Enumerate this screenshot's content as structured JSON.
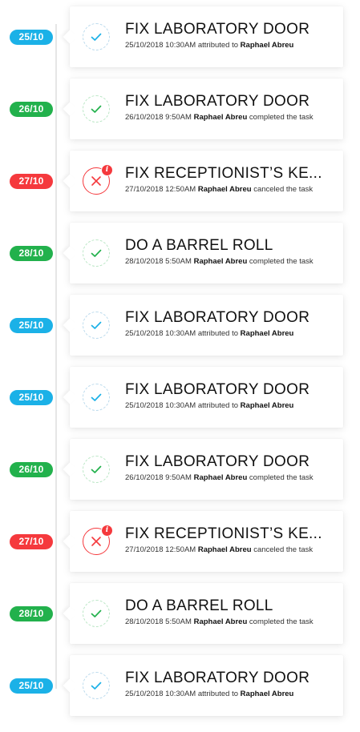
{
  "colors": {
    "assigned": "#1bb1e7",
    "completed": "#22b14c",
    "canceled": "#f5393d"
  },
  "entries": [
    {
      "date": "25/10",
      "status": "assigned",
      "title": "FIX LABORATORY DOOR",
      "timestamp": "25/10/2018 10:30AM",
      "pre": "attributed to",
      "user": "Raphael Abreu",
      "post": ""
    },
    {
      "date": "26/10",
      "status": "completed",
      "title": "FIX LABORATORY DOOR",
      "timestamp": "26/10/2018 9:50AM",
      "pre": "",
      "user": "Raphael Abreu",
      "post": "completed the task"
    },
    {
      "date": "27/10",
      "status": "canceled",
      "title": "FIX RECEPTIONIST’S KE...",
      "timestamp": "27/10/2018 12:50AM",
      "pre": "",
      "user": "Raphael Abreu",
      "post": "canceled the task"
    },
    {
      "date": "28/10",
      "status": "completed",
      "title": "DO A BARREL ROLL",
      "timestamp": "28/10/2018 5:50AM",
      "pre": "",
      "user": "Raphael Abreu",
      "post": "completed the task"
    },
    {
      "date": "25/10",
      "status": "assigned",
      "title": "FIX LABORATORY DOOR",
      "timestamp": "25/10/2018 10:30AM",
      "pre": "attributed to",
      "user": "Raphael Abreu",
      "post": ""
    },
    {
      "date": "25/10",
      "status": "assigned",
      "title": "FIX LABORATORY DOOR",
      "timestamp": "25/10/2018 10:30AM",
      "pre": "attributed to",
      "user": "Raphael Abreu",
      "post": ""
    },
    {
      "date": "26/10",
      "status": "completed",
      "title": "FIX LABORATORY DOOR",
      "timestamp": "26/10/2018 9:50AM",
      "pre": "",
      "user": "Raphael Abreu",
      "post": "completed the task"
    },
    {
      "date": "27/10",
      "status": "canceled",
      "title": "FIX RECEPTIONIST’S KE...",
      "timestamp": "27/10/2018 12:50AM",
      "pre": "",
      "user": "Raphael Abreu",
      "post": "canceled the task"
    },
    {
      "date": "28/10",
      "status": "completed",
      "title": "DO A BARREL ROLL",
      "timestamp": "28/10/2018 5:50AM",
      "pre": "",
      "user": "Raphael Abreu",
      "post": "completed the task"
    },
    {
      "date": "25/10",
      "status": "assigned",
      "title": "FIX LABORATORY DOOR",
      "timestamp": "25/10/2018 10:30AM",
      "pre": "attributed to",
      "user": "Raphael Abreu",
      "post": ""
    }
  ],
  "info_badge": "i"
}
